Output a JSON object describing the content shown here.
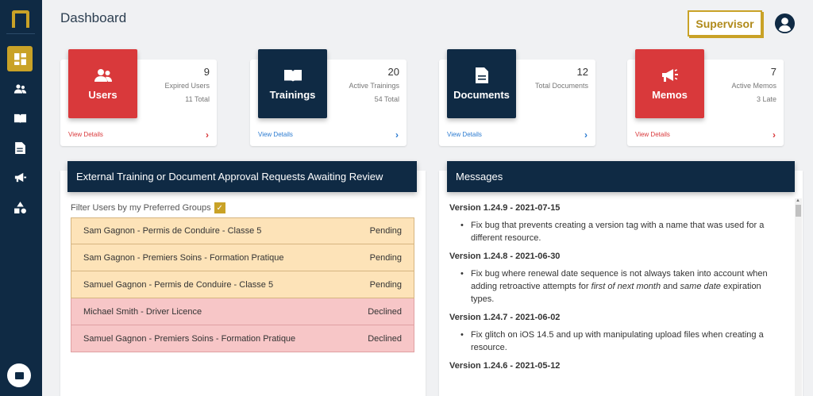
{
  "header": {
    "title": "Dashboard",
    "role_button": "Supervisor"
  },
  "colors": {
    "navy": "#0f2a44",
    "gold": "#c9a227",
    "red": "#d9393b",
    "pending": "#fde3b8",
    "declined": "#f7c6c7"
  },
  "sidebar": {
    "items": [
      {
        "icon": "dashboard-icon",
        "active": true
      },
      {
        "icon": "users-icon",
        "active": false
      },
      {
        "icon": "book-icon",
        "active": false
      },
      {
        "icon": "document-icon",
        "active": false
      },
      {
        "icon": "megaphone-icon",
        "active": false
      },
      {
        "icon": "shapes-icon",
        "active": false
      }
    ]
  },
  "cards": [
    {
      "label": "Users",
      "count": "9",
      "sub1": "Expired Users",
      "sub2": "11 Total",
      "link": "View Details",
      "chevron": "›",
      "icon": "users-icon"
    },
    {
      "label": "Trainings",
      "count": "20",
      "sub1": "Active Trainings",
      "sub2": "54 Total",
      "link": "View Details",
      "chevron": "›",
      "icon": "book-icon"
    },
    {
      "label": "Documents",
      "count": "12",
      "sub1": "Total Documents",
      "sub2": "",
      "link": "View Details",
      "chevron": "›",
      "icon": "document-icon"
    },
    {
      "label": "Memos",
      "count": "7",
      "sub1": "Active Memos",
      "sub2": "3 Late",
      "link": "View Details",
      "chevron": "›",
      "icon": "megaphone-icon"
    }
  ],
  "requests": {
    "title": "External Training or Document Approval Requests Awaiting Review",
    "filter_label": "Filter Users by my Preferred Groups",
    "rows": [
      {
        "name": "Sam Gagnon - Permis de Conduire - Classe 5",
        "status": "Pending"
      },
      {
        "name": "Sam Gagnon - Premiers Soins - Formation Pratique",
        "status": "Pending"
      },
      {
        "name": "Samuel Gagnon - Permis de Conduire - Classe 5",
        "status": "Pending"
      },
      {
        "name": "Michael Smith - Driver Licence",
        "status": "Declined"
      },
      {
        "name": "Samuel Gagnon - Premiers Soins - Formation Pratique",
        "status": "Declined"
      }
    ]
  },
  "messages": {
    "title": "Messages",
    "entries": [
      {
        "version": "Version 1.24.9 - 2021-07-15",
        "item": "Fix bug that prevents creating a version tag with a name that was used for a different resource."
      },
      {
        "version": "Version 1.24.8 - 2021-06-30",
        "item_pre": "Fix bug where renewal date sequence is not always taken into account when adding retroactive attempts for ",
        "item_em1": "first of next month",
        "item_mid": " and ",
        "item_em2": "same date",
        "item_post": " expiration types."
      },
      {
        "version": "Version 1.24.7 - 2021-06-02",
        "item": "Fix glitch on iOS 14.5 and up with manipulating upload files when creating a resource."
      },
      {
        "version": "Version 1.24.6 - 2021-05-12"
      }
    ]
  }
}
